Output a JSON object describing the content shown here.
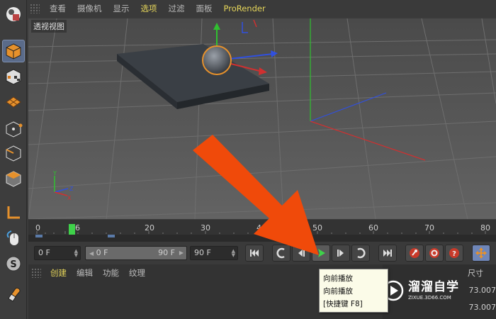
{
  "menubar": {
    "items": [
      "查看",
      "摄像机",
      "显示",
      "选项",
      "过滤",
      "面板",
      "ProRender"
    ],
    "active_index": 3
  },
  "viewport": {
    "label": "透视视图"
  },
  "timeline": {
    "ticks": [
      "0",
      "6",
      "20",
      "30",
      "40",
      "50",
      "60",
      "70",
      "80"
    ],
    "current_frame": "6"
  },
  "transport": {
    "current_frame": "0 F",
    "range_start": "0 F",
    "range_end": "90 F",
    "end_frame": "90 F"
  },
  "bottom_tabs": {
    "items": [
      "创建",
      "编辑",
      "功能",
      "纹理"
    ],
    "active_index": 0
  },
  "attributes": {
    "label_size": "尺寸",
    "value_1": "73.007",
    "value_2": "73.007"
  },
  "tooltip": {
    "line1": "向前播放",
    "line2": "向前播放",
    "line3": "[快捷键 F8]"
  },
  "watermark": {
    "title": "溜溜自学",
    "subtitle": "ZIXUE.3D66.COM"
  },
  "colors": {
    "active_menu": "#e6d65a",
    "play_green": "#3fd14a",
    "annotation_arrow": "#f04a0a",
    "axis_x": "#d03030",
    "axis_y": "#30c030",
    "axis_z": "#3050e0"
  },
  "icons": [
    "cube-icon",
    "checker-cube-icon",
    "grid-icon",
    "point-cube-icon",
    "edge-cube-icon",
    "poly-cube-icon",
    "axis-icon",
    "mouse-icon",
    "snap-icon",
    "magnet-icon"
  ]
}
